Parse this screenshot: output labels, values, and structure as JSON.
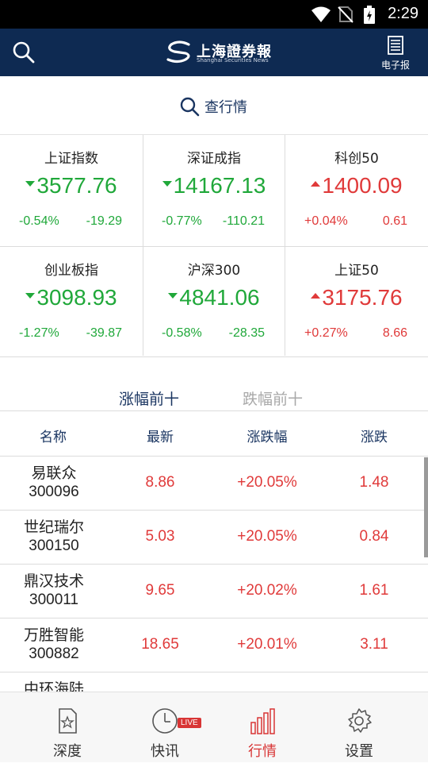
{
  "status_bar": {
    "time": "2:29"
  },
  "app_bar": {
    "logo_text": "上海證券報",
    "logo_sub": "Shanghai Securities News",
    "epaper_label": "电子报"
  },
  "lookup": {
    "label": "查行情"
  },
  "indices": [
    {
      "name": "上证指数",
      "price": "3577.76",
      "pct": "-0.54%",
      "change": "-19.29",
      "direction": "down"
    },
    {
      "name": "深证成指",
      "price": "14167.13",
      "pct": "-0.77%",
      "change": "-110.21",
      "direction": "down"
    },
    {
      "name": "科创50",
      "price": "1400.09",
      "pct": "+0.04%",
      "change": "0.61",
      "direction": "up"
    },
    {
      "name": "创业板指",
      "price": "3098.93",
      "pct": "-1.27%",
      "change": "-39.87",
      "direction": "down"
    },
    {
      "name": "沪深300",
      "price": "4841.06",
      "pct": "-0.58%",
      "change": "-28.35",
      "direction": "down"
    },
    {
      "name": "上证50",
      "price": "3175.76",
      "pct": "+0.27%",
      "change": "8.66",
      "direction": "up"
    }
  ],
  "tabs": {
    "gainers": "涨幅前十",
    "losers": "跌幅前十"
  },
  "table": {
    "headers": [
      "名称",
      "最新",
      "涨跌幅",
      "涨跌"
    ],
    "rows": [
      {
        "name": "易联众",
        "code": "300096",
        "price": "8.86",
        "pct": "+20.05%",
        "change": "1.48"
      },
      {
        "name": "世纪瑞尔",
        "code": "300150",
        "price": "5.03",
        "pct": "+20.05%",
        "change": "0.84"
      },
      {
        "name": "鼎汉技术",
        "code": "300011",
        "price": "9.65",
        "pct": "+20.02%",
        "change": "1.61"
      },
      {
        "name": "万胜智能",
        "code": "300882",
        "price": "18.65",
        "pct": "+20.01%",
        "change": "3.11"
      },
      {
        "name": "中环海陆",
        "code": "",
        "price": "",
        "pct": "",
        "change": ""
      }
    ]
  },
  "bottom_nav": {
    "items": [
      {
        "label": "深度",
        "icon": "document-star-icon"
      },
      {
        "label": "快讯",
        "icon": "clock-icon"
      },
      {
        "label": "行情",
        "icon": "bar-chart-icon"
      },
      {
        "label": "设置",
        "icon": "gear-icon"
      }
    ],
    "live_badge": "LIVE",
    "active_index": 2
  },
  "colors": {
    "brand": "#0e2a52",
    "up": "#e03a3a",
    "down": "#20a83a",
    "active_tab": "#d83535"
  }
}
